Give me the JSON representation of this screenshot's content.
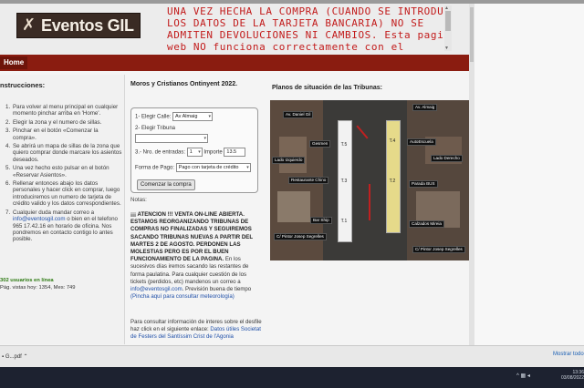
{
  "header": {
    "logo_text": "Eventos GIL",
    "notice_lines": [
      "UNA VEZ HECHA LA COMPRA (CUANDO SE INTRODUCEN",
      "LOS DATOS DE LA TARJETA BANCARIA) NO SE",
      "ADMITEN DEVOLUCIONES NI CAMBIOS. Esta pagina",
      "web NO funciona correctamente con el"
    ]
  },
  "nav": {
    "home": "Home"
  },
  "sidebar": {
    "title": "nstrucciones:",
    "steps": [
      {
        "n": "1.",
        "text": "Para volver al menu principal en cualquier momento pinchar arriba en 'Home'."
      },
      {
        "n": "2.",
        "text": "Elegir la zona y el numero de sillas."
      },
      {
        "n": "3.",
        "text": "Pinchar en el botón «Comenzar la compra»."
      },
      {
        "n": "4.",
        "text": "Se abrirá un mapa de sillas de la zona que quiero comprar donde marcare los asientos deseados."
      },
      {
        "n": "5.",
        "text": "Una vez hecho esto pulsar en el botón «Reservar Asientos»."
      },
      {
        "n": "6.",
        "text": "Rellenar entonces abajo los datos personales y hacer click en comprar, luego introduciremos un numero de tarjeta de crédito valido y los datos correspondientes."
      },
      {
        "n": "7.",
        "text_before": "Cualquier duda mandar correo a ",
        "link": "info@eventosgil.com",
        "text_after": " o bien en el telefono 965 17.42.16 en horario de oficina. Nos pondremos en contacto contigo lo antes posible."
      }
    ],
    "online": "302 usuarios en línea",
    "visits": "Pág. vistas hoy: 1354, Mes: 749"
  },
  "main": {
    "heading": "Moros y Cristianos Ontinyent 2022.",
    "form": {
      "calle_label": "1- Elegir Calle:",
      "calle_value": "Av Almaig",
      "tribuna_label": "2- Elegir Tribuna",
      "tribuna_value": "",
      "entradas_label": "3.- Nro. de entradas:",
      "entradas_value": "1",
      "importe_label": "Importe",
      "importe_value": "13.5",
      "pago_label": "Forma de Pago:",
      "pago_value": "Pago con tarjeta de crédito",
      "submit": "Comenzar la compra"
    },
    "notas_label": "Notas:",
    "aviso_bold": "¡¡¡ ATENCION !!! VENTA ON-LINE ABIERTA. ESTAMOS REORGANIZANDO TRIBUNAS DE COMPRAS NO FINALIZADAS Y SEGUIREMOS SACANDO TRIBUNAS NUEVAS A PARTIR DEL MARTES 2 DE AGOSTO. PERDONEN LAS MOLESTIAS PERO ES POR EL BUEN FUNCIONAMIENTO DE LA PAGINA.",
    "aviso_rest": " En los sucesivos días iremos sacando las restantes de forma paulatina. Para cualquier cuestión de los tickets (perdidos, etc) mandenos un correo a ",
    "aviso_email": "info@eventosgil.com",
    "aviso_tail": ". Previsión buena de tiempo ",
    "aviso_link": "(Pincha aquí para consultar meteorología)",
    "info_text": "Para consultar información de interes sobre el desfile haz click en el siguiente enlace: ",
    "info_link": "Datos útiles Societat de Festers del Santíssim Crist de l'Agonia"
  },
  "planos": {
    "heading": "Planos de situación de las Tribunas:",
    "labels": {
      "daniel": "Av. Daniel Gil",
      "gesmen": "Gesmen",
      "izquierdo": "Lado Izquierdo",
      "restaurante": "Restaurante Chino",
      "barship": "Bar Ship",
      "sagrelles_l": "C/ Pintor Josep Segrelles",
      "almaig": "Av. Almaig",
      "autoescuela": "AutoEscuela",
      "derecho": "Lado Derecho",
      "parada": "Parada BUS",
      "calzados": "Calzados Mireia",
      "sagrelles_r": "C/ Pintor Josep Segrelles"
    },
    "tribunas": [
      "T.5",
      "T.4",
      "T.3",
      "T.2",
      "T.1"
    ]
  },
  "browser": {
    "download_file": "G...pdf",
    "download_all": "Mostrar todo"
  },
  "taskbar": {
    "time": "13:36",
    "date": "03/08/2022"
  }
}
